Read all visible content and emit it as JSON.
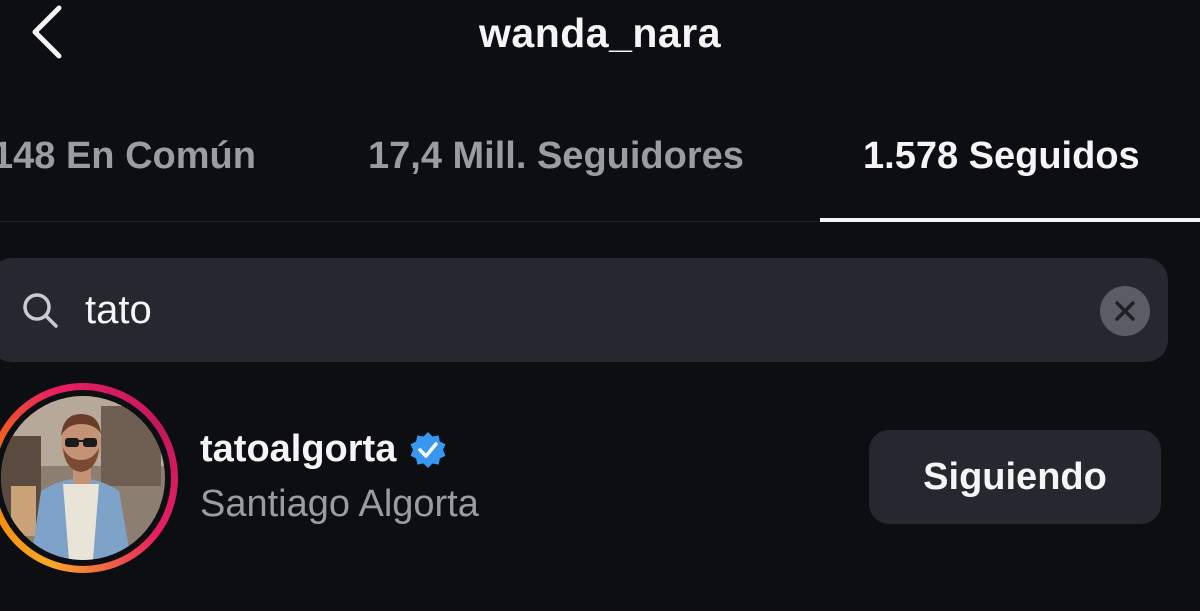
{
  "header": {
    "title": "wanda_nara",
    "back_icon": "chevron-left-icon"
  },
  "tabs": [
    {
      "label": "148 En Común",
      "active": false
    },
    {
      "label": "17,4 Mill. Seguidores",
      "active": false
    },
    {
      "label": "1.578 Seguidos",
      "active": true
    }
  ],
  "search": {
    "value": "tato",
    "icon": "search-icon",
    "clear_icon": "close-icon"
  },
  "results": [
    {
      "username": "tatoalgorta",
      "verified": true,
      "full_name": "Santiago Algorta",
      "button_label": "Siguiendo",
      "has_story_ring": true
    }
  ],
  "colors": {
    "background": "#0c0e12",
    "surface": "#25282e",
    "text_primary": "#f5f5f5",
    "text_secondary": "#9a9ca1",
    "verified_blue": "#3897f0",
    "story_ring_start": "#f9a825",
    "story_ring_end": "#e91e63"
  }
}
